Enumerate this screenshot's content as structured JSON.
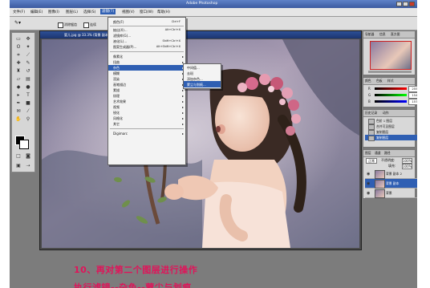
{
  "app": {
    "title": "Adobe Photoshop"
  },
  "menubar": {
    "items": [
      "文件(F)",
      "编辑(E)",
      "图像(I)",
      "图层(L)",
      "选择(S)",
      "滤镜(T)",
      "视图(V)",
      "窗口(W)",
      "帮助(H)"
    ],
    "active_index": 5
  },
  "options": {
    "checkbox1": "消除锯齿",
    "checkbox2": "连续"
  },
  "palette_well": [
    "画笔",
    "工具预设",
    "图层复合"
  ],
  "document": {
    "title": "婴儿.jpg @ 33.3% (背景 副本, RGB)"
  },
  "filter_menu": {
    "items": [
      {
        "label": "颜色(F)",
        "shortcut": "Ctrl+F"
      },
      {
        "label": "抽出(X)...",
        "shortcut": "Alt+Ctrl+X"
      },
      {
        "label": "滤镜库(G)...",
        "shortcut": ""
      },
      {
        "label": "液化(L)...",
        "shortcut": "Shift+Ctrl+X"
      },
      {
        "label": "图案生成器(P)...",
        "shortcut": "Alt+Shift+Ctrl+X"
      },
      {
        "label": "像素化",
        "shortcut": ""
      },
      {
        "label": "扭曲",
        "shortcut": ""
      },
      {
        "label": "杂色",
        "shortcut": ""
      },
      {
        "label": "模糊",
        "shortcut": ""
      },
      {
        "label": "渲染",
        "shortcut": ""
      },
      {
        "label": "画笔描边",
        "shortcut": ""
      },
      {
        "label": "素描",
        "shortcut": ""
      },
      {
        "label": "纹理",
        "shortcut": ""
      },
      {
        "label": "艺术效果",
        "shortcut": ""
      },
      {
        "label": "视频",
        "shortcut": ""
      },
      {
        "label": "锐化",
        "shortcut": ""
      },
      {
        "label": "风格化",
        "shortcut": ""
      },
      {
        "label": "其它",
        "shortcut": ""
      },
      {
        "label": "Digimarc",
        "shortcut": ""
      }
    ],
    "highlighted_index": 7
  },
  "noise_submenu": {
    "items": [
      "中间值...",
      "去斑",
      "添加杂色...",
      "蒙尘与划痕..."
    ],
    "highlighted_index": 3
  },
  "navigator": {
    "tabs": [
      "导航器",
      "信息",
      "直方图"
    ]
  },
  "color_panel": {
    "tabs": [
      "颜色",
      "色板",
      "样式"
    ],
    "channels": [
      {
        "label": "R",
        "value": "255"
      },
      {
        "label": "G",
        "value": "154"
      },
      {
        "label": "B",
        "value": "157"
      }
    ]
  },
  "history_panel": {
    "tabs": [
      "历史记录",
      "动作"
    ],
    "items": [
      "色阶 1 图层",
      "合并可见图层",
      "复制图层",
      "复制图层"
    ],
    "highlighted_index": 3
  },
  "layers_panel": {
    "tabs": [
      "图层",
      "通道",
      "路径"
    ],
    "mode": "正常",
    "opacity_label": "不透明度:",
    "opacity": "100%",
    "fill_label": "填充:",
    "fill": "100%",
    "layers": [
      "背景 副本 2",
      "背景 副本",
      "背景"
    ],
    "highlighted_index": 1
  },
  "caption": {
    "line1": "10、再对第二个图层进行操作",
    "line2": "执行滤镜--杂色--蒙尘与划痕"
  },
  "colors": {
    "accent": "#2f5fb3",
    "caption": "#e0145a"
  }
}
